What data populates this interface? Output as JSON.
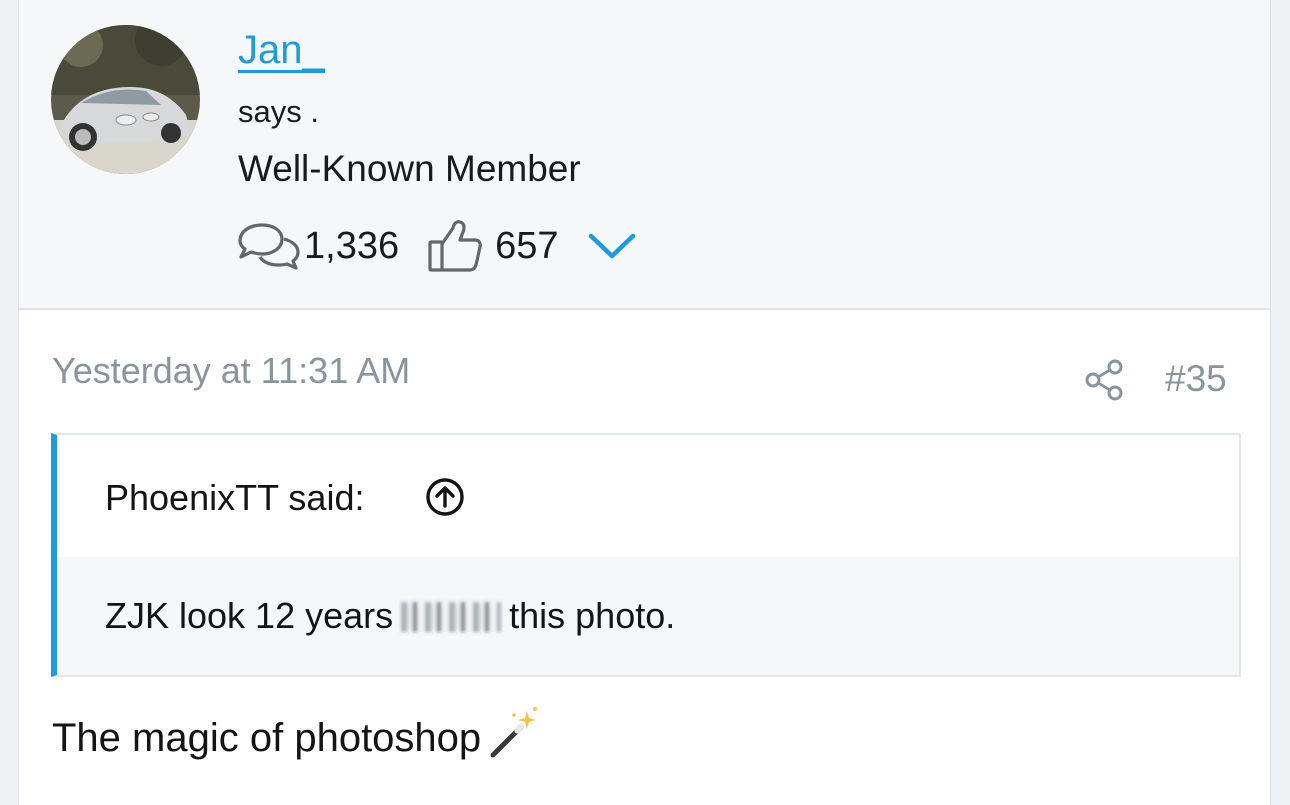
{
  "user": {
    "name": "Jan_",
    "tagline": "says .",
    "title": "Well-Known Member",
    "messages_count": "1,336",
    "reactions_count": "657"
  },
  "post": {
    "timestamp": "Yesterday at 11:31 AM",
    "number": "#35",
    "quote": {
      "author": "PhoenixTT said:",
      "text_before": "ZJK look 12 years",
      "text_after": "this photo."
    },
    "message": "The magic of photoshop"
  },
  "icons": {
    "messages": "chat-bubbles-icon",
    "reactions": "thumbs-up-icon",
    "expand": "chevron-down-icon",
    "share": "share-icon",
    "jump": "arrow-up-circle-icon",
    "wand": "magic-wand-emoji"
  },
  "colors": {
    "accent": "#1d9be0",
    "muted": "#8a949e",
    "user_block_bg": "#f5f7f9"
  }
}
